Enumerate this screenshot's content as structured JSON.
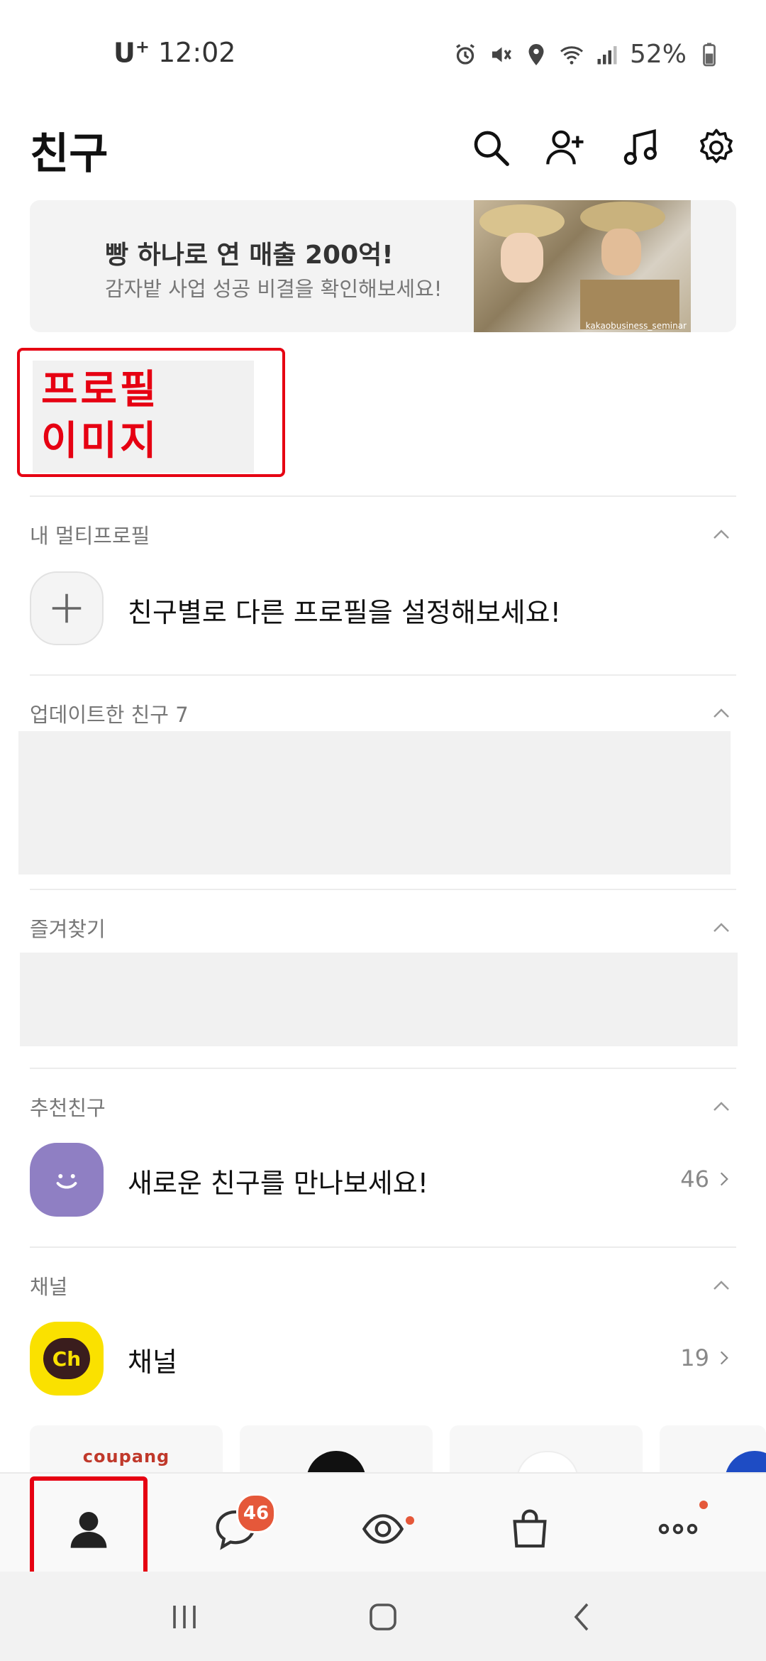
{
  "status_bar": {
    "carrier": "U",
    "carrier_sup": "+",
    "time": "12:02",
    "battery": "52%"
  },
  "header": {
    "title": "친구",
    "icons": [
      "search-icon",
      "add-friend-icon",
      "music-icon",
      "settings-icon"
    ]
  },
  "banner": {
    "title": "빵 하나로 연 매출 200억!",
    "subtitle": "감자밭 사업 성공 비결을 확인해보세요!",
    "watermark": "kakaobusiness_seminar"
  },
  "profile": {
    "label_line1": "프로필",
    "label_line2": "이미지"
  },
  "sections": {
    "multi_profile": {
      "label": "내 멀티프로필",
      "item_text": "친구별로 다른 프로필을 설정해보세요!"
    },
    "updated_friends": {
      "label": "업데이트한 친구 7"
    },
    "favorites": {
      "label": "즐겨찾기"
    },
    "recommended": {
      "label": "추천친구",
      "item_text": "새로운 친구를 만나보세요!",
      "count": "46"
    },
    "channel": {
      "label": "채널",
      "item_text": "채널",
      "icon_text": "Ch",
      "count": "19",
      "cards": [
        "coupang"
      ]
    }
  },
  "bottom_nav": {
    "items": [
      "friends-tab",
      "chats-tab",
      "view-tab",
      "shopping-tab",
      "more-tab"
    ],
    "chat_badge": "46"
  },
  "colors": {
    "highlight_red": "#e60012",
    "badge_orange": "#e5583a",
    "kakao_yellow": "#fae100",
    "purple": "#8f7fc3"
  }
}
